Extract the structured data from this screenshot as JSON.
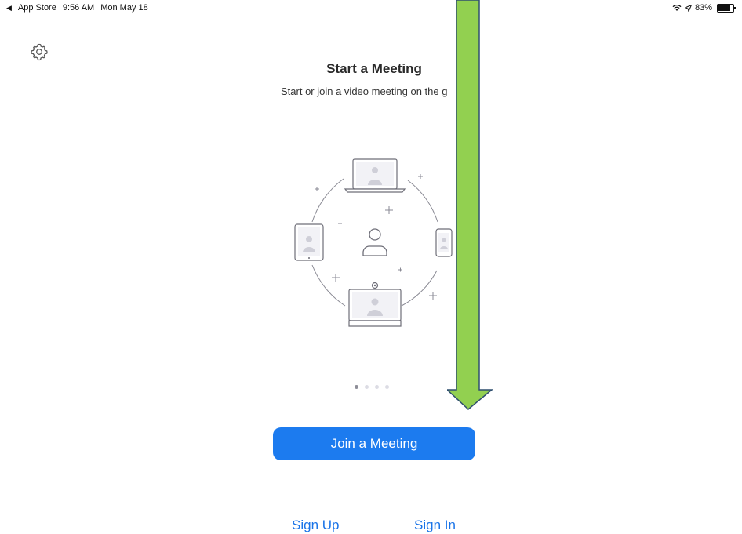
{
  "status_bar": {
    "back_app": "App Store",
    "time": "9:56 AM",
    "date": "Mon May 18",
    "battery": "83%",
    "battery_level": 0.83
  },
  "settings": {
    "icon": "gear-icon"
  },
  "main": {
    "title": "Start a Meeting",
    "subtitle": "Start or join a video meeting on the g"
  },
  "carousel": {
    "page_count": 4,
    "active_index": 0
  },
  "actions": {
    "join_label": "Join a Meeting",
    "sign_up_label": "Sign Up",
    "sign_in_label": "Sign In"
  },
  "annotation": {
    "arrow_color": "#92d050",
    "arrow_outline": "#2f4f6f"
  },
  "colors": {
    "accent": "#1c7bef"
  }
}
